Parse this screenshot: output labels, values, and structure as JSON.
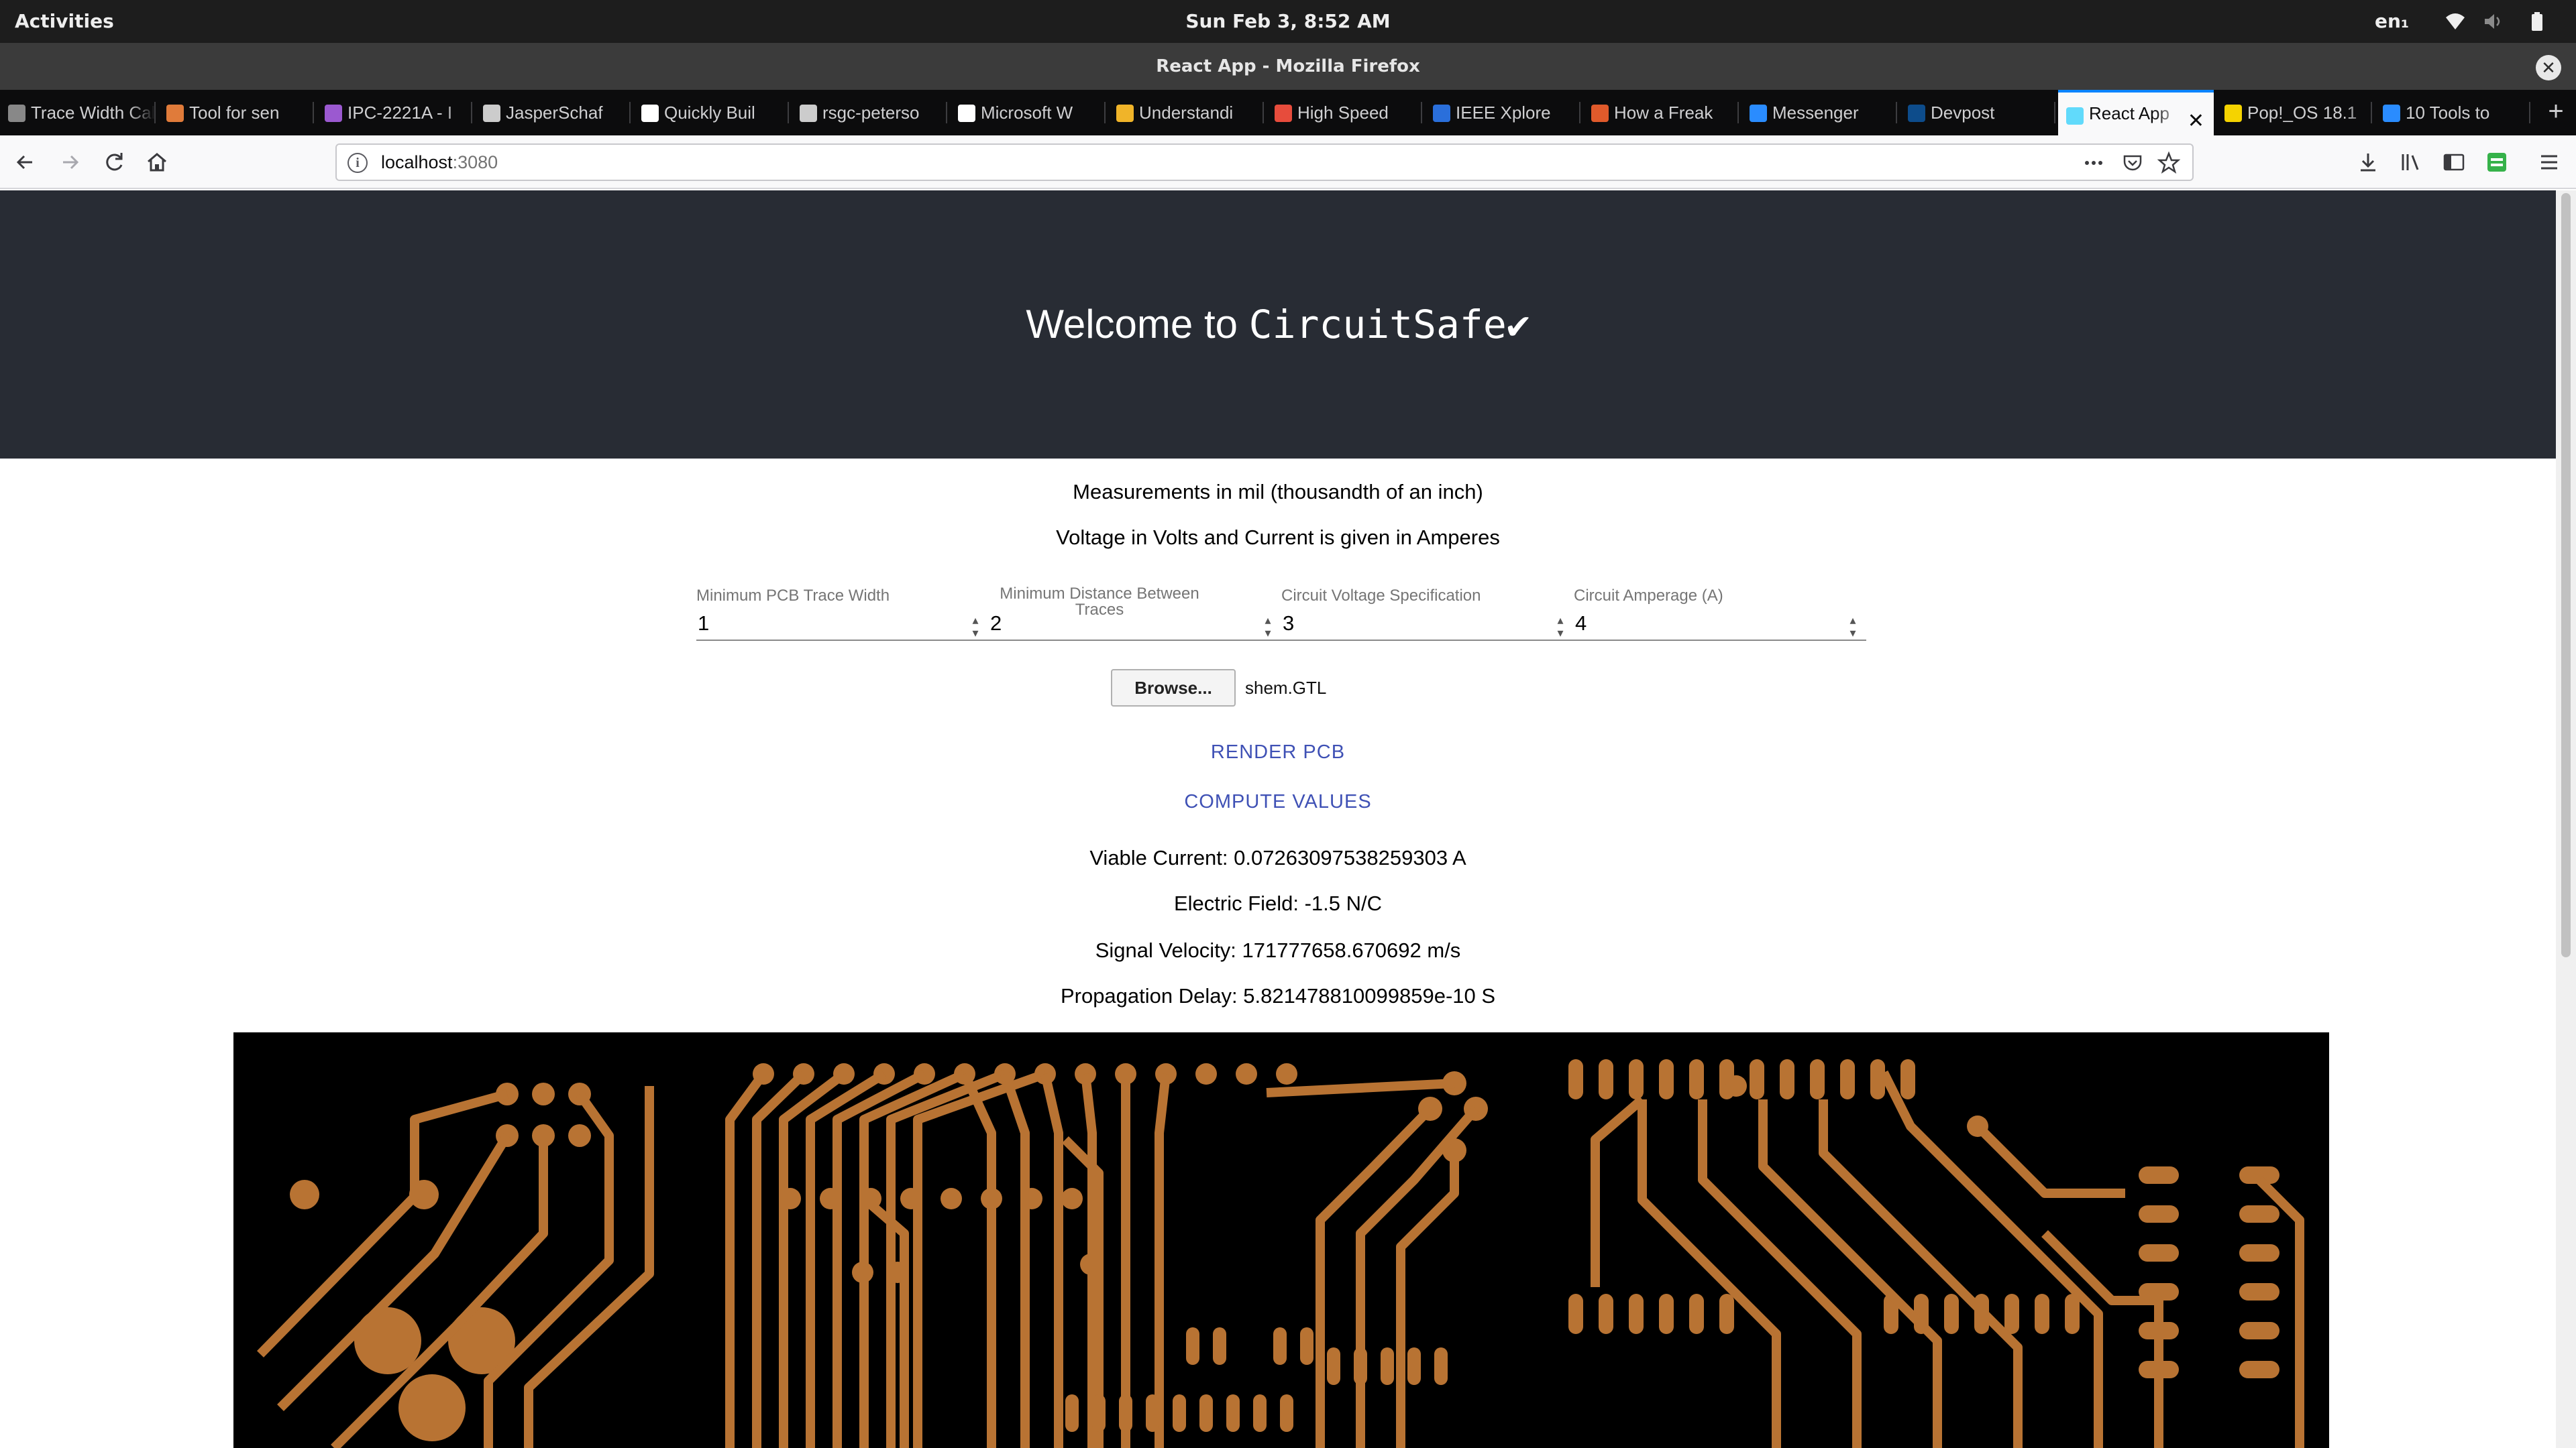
{
  "system": {
    "activities_label": "Activities",
    "clock": "Sun Feb  3,  8:52 AM",
    "language": "en₁"
  },
  "window": {
    "title": "React App - Mozilla Firefox",
    "close_glyph": "✕"
  },
  "tabs": [
    {
      "label": "Trace Width Cal",
      "icon": "calculator-icon",
      "color": "#888888"
    },
    {
      "label": "Tool for sen",
      "icon": "tool-icon",
      "color": "#e07b3a"
    },
    {
      "label": "IPC-2221A - I",
      "icon": "document-icon",
      "color": "#9b59d0"
    },
    {
      "label": "JasperSchaf",
      "icon": "github-icon",
      "color": "#cccccc"
    },
    {
      "label": "Quickly Buil",
      "icon": "medium-icon",
      "color": "#ffffff"
    },
    {
      "label": "rsgc-peterso",
      "icon": "github-icon",
      "color": "#cccccc"
    },
    {
      "label": "Microsoft W",
      "icon": "play-icon",
      "color": "#ffffff"
    },
    {
      "label": "Understandi",
      "icon": "book-icon",
      "color": "#f0b429"
    },
    {
      "label": "High Speed",
      "icon": "hackaday-icon",
      "color": "#e74c3c"
    },
    {
      "label": "IEEE Xplore",
      "icon": "ieee-icon",
      "color": "#2a6fdb"
    },
    {
      "label": "How a Freak",
      "icon": "freak-icon",
      "color": "#e05a2b"
    },
    {
      "label": "Messenger",
      "icon": "messenger-icon",
      "color": "#2a8cff"
    },
    {
      "label": "Devpost",
      "icon": "devpost-icon",
      "color": "#0d4c8b"
    },
    {
      "label": "React App",
      "icon": "react-icon",
      "color": "#61dafb",
      "active": true
    },
    {
      "label": "Pop!_OS 18.1",
      "icon": "popos-icon",
      "color": "#f5d300"
    },
    {
      "label": "10 Tools to",
      "icon": "tools-icon",
      "color": "#2a8cff"
    }
  ],
  "tab_close_glyph": "✕",
  "new_tab_glyph": "+",
  "navbar": {
    "url_host": "localhost",
    "url_port": ":3080"
  },
  "app": {
    "welcome_prefix": "Welcome to ",
    "brand": "CircuitSafe✔",
    "measure_note": "Measurements in mil (thousandth of an inch)",
    "voltage_note": "Voltage in Volts and Current is given in Amperes",
    "fields": [
      {
        "label": "Minimum PCB Trace Width",
        "value": "1"
      },
      {
        "label": "Minimum Distance Between Traces",
        "value": "2"
      },
      {
        "label": "Circuit Voltage Specification",
        "value": "3"
      },
      {
        "label": "Circuit Amperage (A)",
        "value": "4"
      }
    ],
    "spinner_glyph": "▴\n▾",
    "browse_label": "Browse...",
    "file_name": "shem.GTL",
    "render_button": "RENDER PCB",
    "compute_button": "COMPUTE VALUES",
    "results": {
      "viable_current": "Viable Current: 0.07263097538259303 A",
      "electric_field": "Electric Field: -1.5 N/C",
      "signal_velocity": "Signal Velocity: 171777658.670692 m/s",
      "propagation_delay": "Propagation Delay: 5.821478810099859e-10 S"
    }
  },
  "colors": {
    "hero_bg": "#282c34",
    "link": "#3f51b5",
    "pcb_copper": "#b87333",
    "pcb_bg": "#000000",
    "tab_accent": "#0a84ff"
  }
}
